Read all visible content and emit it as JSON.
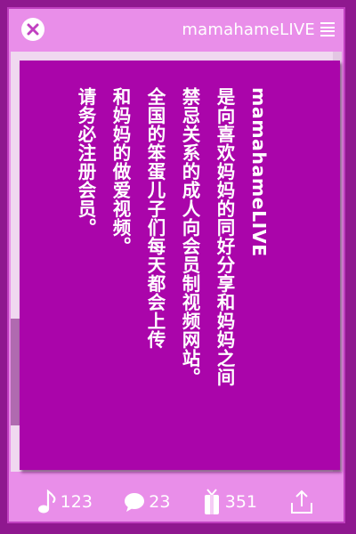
{
  "header": {
    "title": "mamahameLIVE",
    "close_icon": "close-x-icon",
    "menu_icon": "hamburger-menu-icon"
  },
  "modal": {
    "lines": [
      "mamahameLIVE",
      "是向喜欢妈妈的同好分享和妈妈之间",
      "禁忌关系的成人向会员制视频网站。",
      "全国的笨蛋儿子们每天都会上传",
      "和妈妈的做爱视频。",
      "请务必注册会员。"
    ]
  },
  "footer": {
    "music_count": "123",
    "comment_count": "23",
    "gift_count": "351",
    "share_icon": "share-icon"
  },
  "colors": {
    "background": "#8f188f",
    "frame": "#e98ee9",
    "modal": "#aa05aa",
    "text": "#ffffff"
  }
}
